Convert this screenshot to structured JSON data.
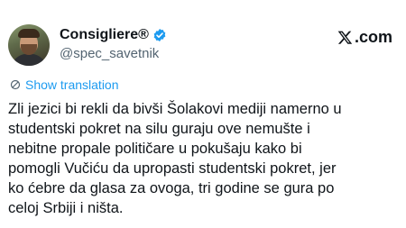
{
  "author": {
    "display_name": "Consigliere®",
    "handle": "@spec_savetnik",
    "verified": true
  },
  "brand": {
    "label": ".com",
    "icon": "x-logo-icon"
  },
  "translation": {
    "label": "Show translation",
    "icon": "globe-icon"
  },
  "tweet": {
    "text": "Zli jezici bi rekli da bivši Šolakovi mediji namerno u\nstudentski pokret na silu guraju ove nemušte i\nnebitne propale političare u pokušaju kako bi\npomogli Vučiću da upropasti studentski pokret, jer\nko ćebre da glasa za ovoga, tri godine se gura po\nceloj Srbiji i ništa."
  },
  "colors": {
    "link": "#1d9bf0",
    "verified": "#1d9bf0",
    "secondary_text": "#536471",
    "primary_text": "#0f1419"
  }
}
